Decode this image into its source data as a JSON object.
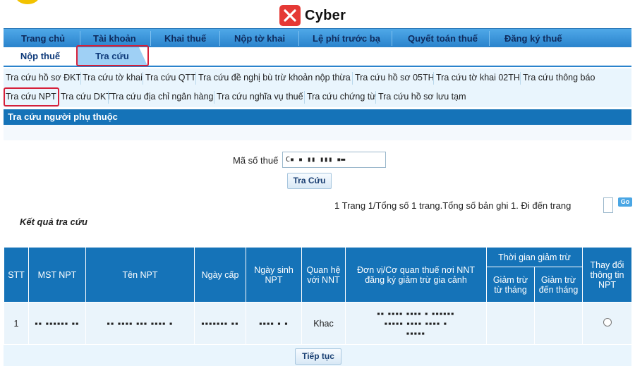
{
  "brand": {
    "name": "Cyber"
  },
  "topnav": [
    "Trang chủ",
    "Tài khoản",
    "Khai thuế",
    "Nộp tờ khai",
    "Lệ phí trước bạ",
    "Quyết toán thuế",
    "Đăng ký thuế"
  ],
  "subtabs": [
    "Nộp thuế",
    "Tra cứu"
  ],
  "lookup_links_row1": [
    "Tra cứu hồ sơ ĐKT",
    "Tra cứu tờ khai",
    "Tra cứu QTT",
    "Tra cứu đề nghị bù trừ khoản nộp thừa",
    "Tra cứu hồ sơ 05TH",
    "Tra cứu tờ khai 02TH",
    "Tra cứu thông báo"
  ],
  "lookup_links_row2": [
    "Tra cứu NPT",
    "Tra cứu DKT",
    "Tra cứu địa chỉ ngân hàng",
    "Tra cứu nghĩa vụ thuế",
    "Tra cứu chứng từ",
    "Tra cứu hồ sơ lưu tạm"
  ],
  "section_title": "Tra cứu người phụ thuộc",
  "search": {
    "label": "Mã số thuế",
    "value": "C▪ ▪ ▮▮ ▮▮▮ ▪▬",
    "button": "Tra Cứu"
  },
  "pagination": {
    "text": "1  Trang 1/Tổng số 1 trang.Tổng số bản ghi 1. Đi đến trang",
    "go": "Go"
  },
  "results_title": "Kết quả tra cứu",
  "table": {
    "headers": {
      "stt": "STT",
      "mst": "MST NPT",
      "name": "Tên NPT",
      "issue_date": "Ngày cấp",
      "birth_date": "Ngày sinh NPT",
      "relation": "Quan hệ với NNT",
      "unit": "Đơn vị/Cơ quan thuế nơi NNT đăng ký giảm trừ gia cảnh",
      "period": "Thời gian giảm trừ",
      "from": "Giảm trừ từ tháng",
      "to": "Giảm trừ đến tháng",
      "change": "Thay đổi thông tin NPT"
    },
    "rows": [
      {
        "stt": "1",
        "mst": "▪▪ ▪▪▪▪▪▪ ▪▪",
        "name": "▪▪ ▪▪▪▪ ▪▪▪ ▪▪▪▪ ▪",
        "issue_date": "▪▪▪▪▪▪▪ ▪▪",
        "birth_date": "▪▪▪▪ ▪ ▪",
        "relation": "Khac",
        "unit_line1": "▪▪ ▪▪▪▪ ▪▪▪▪ ▪ ▪▪▪▪▪▪",
        "unit_line2": "▪▪▪▪▪ ▪▪▪▪ ▪▪▪▪ ▪",
        "unit_line3": "▪▪▪▪▪",
        "from": "",
        "to": ""
      }
    ]
  },
  "continue_button": "Tiếp tục"
}
